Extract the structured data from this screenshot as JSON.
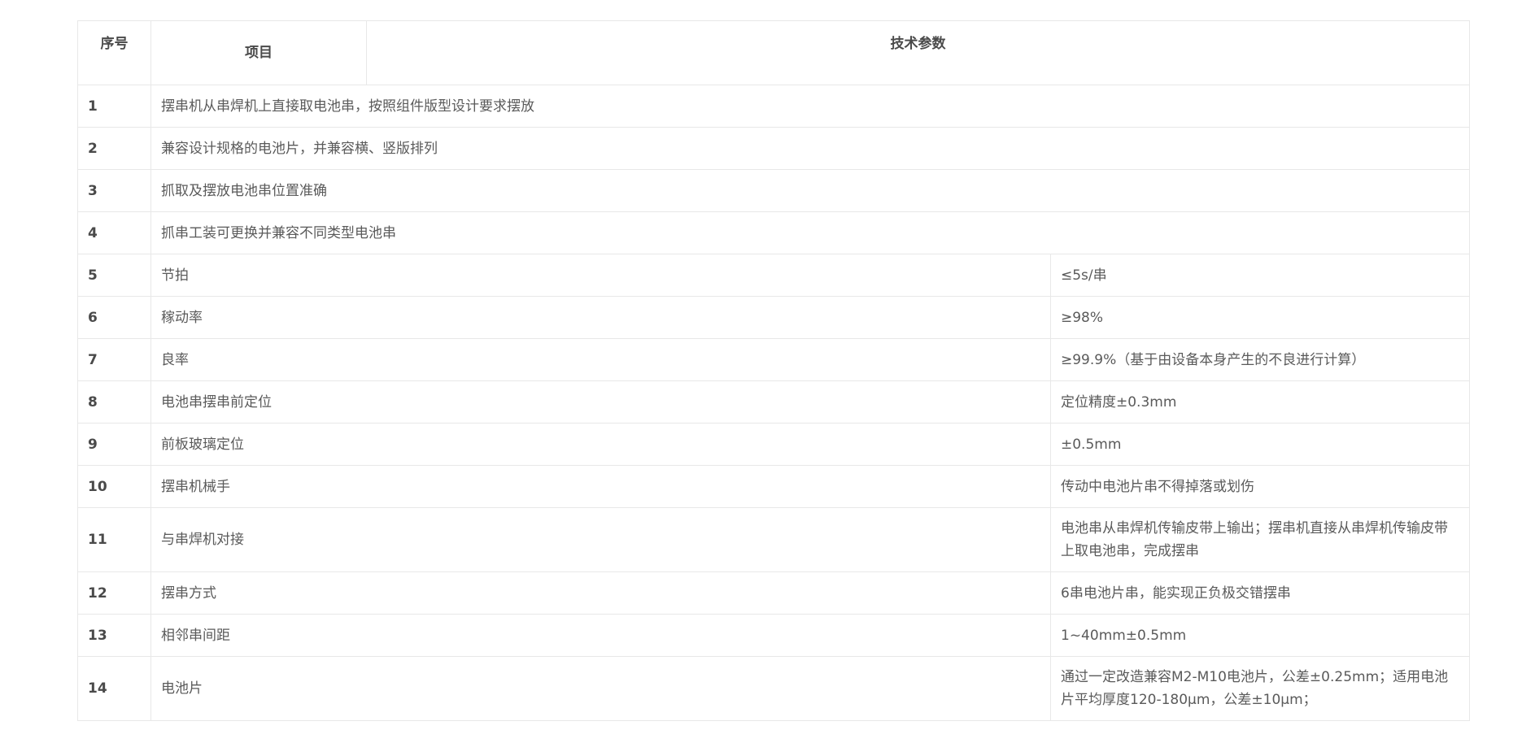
{
  "table": {
    "header": {
      "index": "序号",
      "item": "项目",
      "param": "技术参数"
    },
    "rows": [
      {
        "index": "1",
        "item": "摆串机从串焊机上直接取电池串，按照组件版型设计要求摆放",
        "value": ""
      },
      {
        "index": "2",
        "item": "兼容设计规格的电池片，并兼容横、竖版排列",
        "value": ""
      },
      {
        "index": "3",
        "item": "抓取及摆放电池串位置准确",
        "value": ""
      },
      {
        "index": "4",
        "item": "抓串工装可更换并兼容不同类型电池串",
        "value": ""
      },
      {
        "index": "5",
        "item": "节拍",
        "value": "≤5s/串"
      },
      {
        "index": "6",
        "item": "稼动率",
        "value": "≥98%"
      },
      {
        "index": "7",
        "item": "良率",
        "value": "≥99.9%（基于由设备本身产生的不良进行计算）"
      },
      {
        "index": "8",
        "item": "电池串摆串前定位",
        "value": "定位精度±0.3mm"
      },
      {
        "index": "9",
        "item": "前板玻璃定位",
        "value": "±0.5mm"
      },
      {
        "index": "10",
        "item": "摆串机械手",
        "value": "传动中电池片串不得掉落或划伤"
      },
      {
        "index": "11",
        "item": "与串焊机对接",
        "value": "电池串从串焊机传输皮带上输出；摆串机直接从串焊机传输皮带上取电池串，完成摆串"
      },
      {
        "index": "12",
        "item": "摆串方式",
        "value": "6串电池片串，能实现正负极交错摆串"
      },
      {
        "index": "13",
        "item": "相邻串间距",
        "value": "1~40mm±0.5mm"
      },
      {
        "index": "14",
        "item": "电池片",
        "value": "通过一定改造兼容M2-M10电池片，公差±0.25mm；适用电池片平均厚度120-180μm，公差±10μm；"
      }
    ]
  }
}
